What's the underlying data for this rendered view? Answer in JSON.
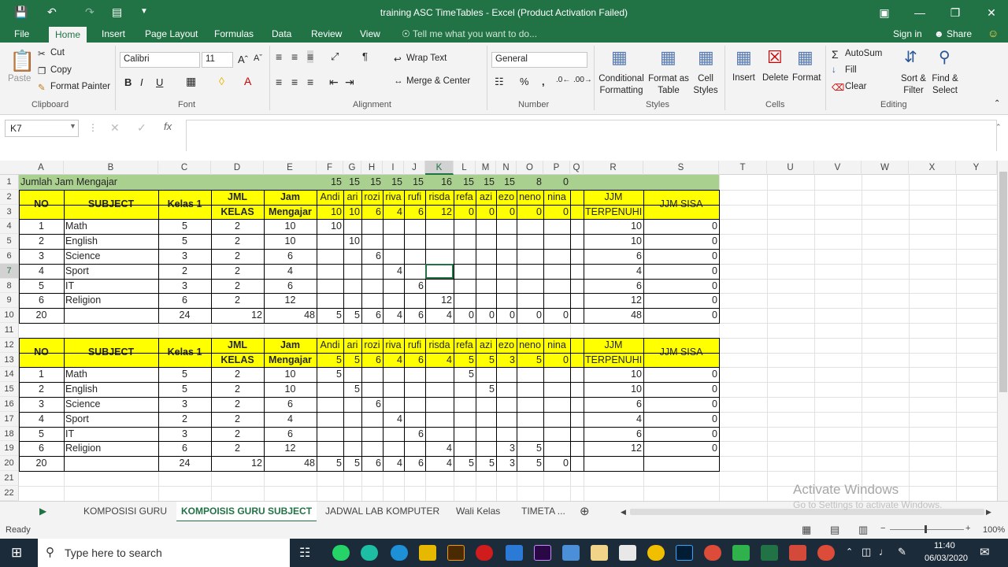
{
  "title": "training ASC TimeTables - Excel (Product Activation Failed)",
  "tabs": [
    "File",
    "Home",
    "Insert",
    "Page Layout",
    "Formulas",
    "Data",
    "Review",
    "View"
  ],
  "tell_me": "Tell me what you want to do...",
  "signin": "Sign in",
  "share": "Share",
  "ribbon": {
    "paste": "Paste",
    "cut": "Cut",
    "copy": "Copy",
    "format_painter": "Format Painter",
    "font_name": "Calibri",
    "font_size": "11",
    "wrap_text": "Wrap Text",
    "merge_center": "Merge & Center",
    "number_format": "General",
    "cond_fmt": "Conditional Formatting",
    "fmt_table": "Format as Table",
    "cell_styles": "Cell Styles",
    "insert": "Insert",
    "delete": "Delete",
    "format": "Format",
    "autosum": "AutoSum",
    "fill": "Fill",
    "clear": "Clear",
    "sort_filter": "Sort & Filter",
    "find_select": "Find & Select",
    "groups": [
      "Clipboard",
      "Font",
      "Alignment",
      "Number",
      "Styles",
      "Cells",
      "Editing"
    ]
  },
  "namebox": "K7",
  "columns": [
    "A",
    "B",
    "C",
    "D",
    "E",
    "F",
    "G",
    "H",
    "I",
    "J",
    "K",
    "L",
    "M",
    "N",
    "O",
    "P",
    "Q",
    "R",
    "S",
    "T",
    "U",
    "V",
    "W",
    "X",
    "Y"
  ],
  "rows": [
    "1",
    "2",
    "3",
    "4",
    "5",
    "6",
    "7",
    "8",
    "9",
    "10",
    "11",
    "12",
    "13",
    "14",
    "15",
    "16",
    "17",
    "18",
    "19",
    "20",
    "21",
    "22"
  ],
  "sheet": {
    "r1_label": "Jumlah Jam Mengajar",
    "r1_vals": [
      "15",
      "15",
      "15",
      "15",
      "15",
      "16",
      "15",
      "15",
      "15",
      "8",
      "0"
    ],
    "hdr": {
      "no": "NO",
      "subject": "SUBJECT",
      "kelas": "Kelas 1",
      "jml1": "JML",
      "jml2": "KELAS",
      "jam1": "Jam",
      "jam2": "Mengajar",
      "jjm1": "JJM",
      "jjm2": "TERPENUHI",
      "sisa": "JJM SISA"
    },
    "teachers": [
      "Andi",
      "ari",
      "rozi",
      "riva",
      "rufi",
      "risda",
      "refa",
      "azi",
      "ezo",
      "neno",
      "nina"
    ],
    "t1_r3": [
      "10",
      "10",
      "6",
      "4",
      "6",
      "12",
      "0",
      "0",
      "0",
      "0",
      "0"
    ],
    "t1_rows": [
      {
        "no": "1",
        "subject": "Math",
        "kelas": "5",
        "jml": "2",
        "jam": "10",
        "alloc": [
          "10",
          "",
          "",
          "",
          "",
          "",
          "",
          "",
          "",
          "",
          ""
        ],
        "jjm": "10",
        "sisa": "0"
      },
      {
        "no": "2",
        "subject": "English",
        "kelas": "5",
        "jml": "2",
        "jam": "10",
        "alloc": [
          "",
          "10",
          "",
          "",
          "",
          "",
          "",
          "",
          "",
          "",
          ""
        ],
        "jjm": "10",
        "sisa": "0"
      },
      {
        "no": "3",
        "subject": "Science",
        "kelas": "3",
        "jml": "2",
        "jam": "6",
        "alloc": [
          "",
          "",
          "6",
          "",
          "",
          "",
          "",
          "",
          "",
          "",
          ""
        ],
        "jjm": "6",
        "sisa": "0"
      },
      {
        "no": "4",
        "subject": "Sport",
        "kelas": "2",
        "jml": "2",
        "jam": "4",
        "alloc": [
          "",
          "",
          "",
          "4",
          "",
          "",
          "",
          "",
          "",
          "",
          ""
        ],
        "jjm": "4",
        "sisa": "0"
      },
      {
        "no": "5",
        "subject": "IT",
        "kelas": "3",
        "jml": "2",
        "jam": "6",
        "alloc": [
          "",
          "",
          "",
          "",
          "6",
          "",
          "",
          "",
          "",
          "",
          ""
        ],
        "jjm": "6",
        "sisa": "0"
      },
      {
        "no": "6",
        "subject": "Religion",
        "kelas": "6",
        "jml": "2",
        "jam": "12",
        "alloc": [
          "",
          "",
          "",
          "",
          "",
          "12",
          "",
          "",
          "",
          "",
          ""
        ],
        "jjm": "12",
        "sisa": "0"
      }
    ],
    "t1_total": {
      "no": "20",
      "kelas": "24",
      "jml": "12",
      "jam": "48",
      "alloc": [
        "5",
        "5",
        "6",
        "4",
        "6",
        "4",
        "0",
        "0",
        "0",
        "0",
        "0"
      ],
      "jjm": "48",
      "sisa": "0"
    },
    "t2_r13": [
      "5",
      "5",
      "6",
      "4",
      "6",
      "4",
      "5",
      "5",
      "3",
      "5",
      "0"
    ],
    "t2_rows": [
      {
        "no": "1",
        "subject": "Math",
        "kelas": "5",
        "jml": "2",
        "jam": "10",
        "alloc": [
          "5",
          "",
          "",
          "",
          "",
          "",
          "5",
          "",
          "",
          "",
          ""
        ],
        "jjm": "10",
        "sisa": "0"
      },
      {
        "no": "2",
        "subject": "English",
        "kelas": "5",
        "jml": "2",
        "jam": "10",
        "alloc": [
          "",
          "5",
          "",
          "",
          "",
          "",
          "",
          "5",
          "",
          "",
          ""
        ],
        "jjm": "10",
        "sisa": "0"
      },
      {
        "no": "3",
        "subject": "Science",
        "kelas": "3",
        "jml": "2",
        "jam": "6",
        "alloc": [
          "",
          "",
          "6",
          "",
          "",
          "",
          "",
          "",
          "",
          "",
          ""
        ],
        "jjm": "6",
        "sisa": "0"
      },
      {
        "no": "4",
        "subject": "Sport",
        "kelas": "2",
        "jml": "2",
        "jam": "4",
        "alloc": [
          "",
          "",
          "",
          "4",
          "",
          "",
          "",
          "",
          "",
          "",
          ""
        ],
        "jjm": "4",
        "sisa": "0"
      },
      {
        "no": "5",
        "subject": "IT",
        "kelas": "3",
        "jml": "2",
        "jam": "6",
        "alloc": [
          "",
          "",
          "",
          "",
          "6",
          "",
          "",
          "",
          "",
          "",
          ""
        ],
        "jjm": "6",
        "sisa": "0"
      },
      {
        "no": "6",
        "subject": "Religion",
        "kelas": "6",
        "jml": "2",
        "jam": "12",
        "alloc": [
          "",
          "",
          "",
          "",
          "",
          "4",
          "",
          "",
          "3",
          "5",
          ""
        ],
        "jjm": "12",
        "sisa": "0"
      }
    ],
    "t2_total": {
      "no": "20",
      "kelas": "24",
      "jml": "12",
      "jam": "48",
      "alloc": [
        "5",
        "5",
        "6",
        "4",
        "6",
        "4",
        "5",
        "5",
        "3",
        "5",
        "0"
      ],
      "jjm": "",
      "sisa": ""
    }
  },
  "sheet_tabs": [
    "KOMPOSISI GURU",
    "KOMPOISIS GURU SUBJECT",
    "JADWAL LAB KOMPUTER",
    "Wali Kelas",
    "TIMETA ..."
  ],
  "status": "Ready",
  "zoom": "100%",
  "watermark1": "Activate Windows",
  "watermark2": "Go to Settings to activate Windows.",
  "taskbar": {
    "search": "Type here to search",
    "time": "11:40",
    "date": "06/03/2020"
  },
  "colors": {
    "green": "#217346",
    "yellow": "#ffff00",
    "header_green": "#a9d08e"
  }
}
